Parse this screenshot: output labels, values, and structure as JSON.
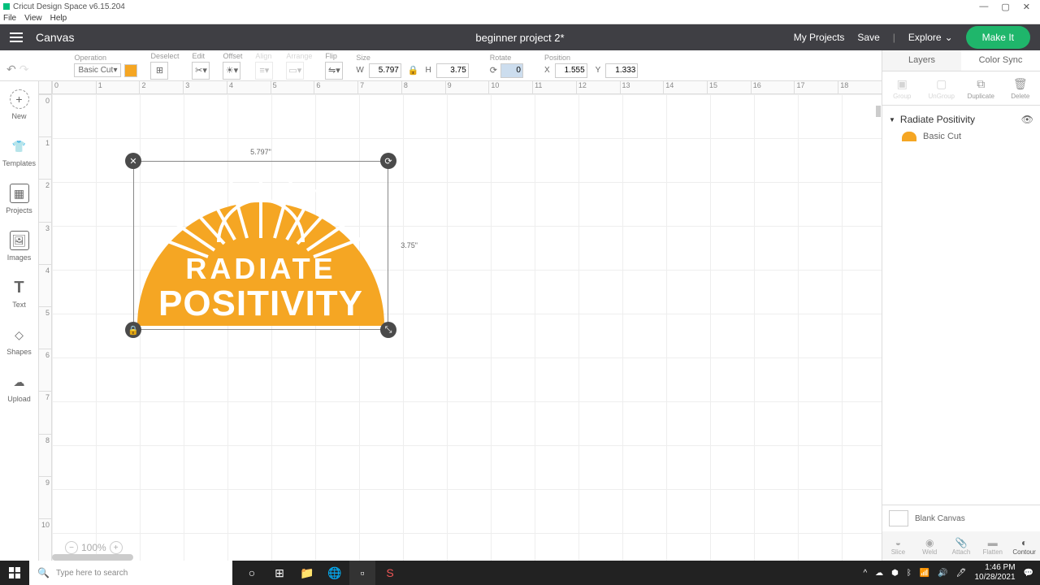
{
  "titlebar": {
    "title": "Cricut Design Space v6.15.204"
  },
  "menubar": {
    "file": "File",
    "view": "View",
    "help": "Help"
  },
  "header": {
    "canvas": "Canvas",
    "project_title": "beginner project 2*",
    "my_projects": "My Projects",
    "save": "Save",
    "explore": "Explore",
    "make_it": "Make It"
  },
  "toolbar": {
    "operation_label": "Operation",
    "operation_value": "Basic Cut",
    "deselect": "Deselect",
    "edit": "Edit",
    "offset": "Offset",
    "align": "Align",
    "arrange": "Arrange",
    "flip": "Flip",
    "size_label": "Size",
    "w": "W",
    "w_val": "5.797",
    "h": "H",
    "h_val": "3.75",
    "rotate_label": "Rotate",
    "rotate_val": "0",
    "position_label": "Position",
    "x": "X",
    "x_val": "1.555",
    "y": "Y",
    "y_val": "1.333"
  },
  "sidebar": {
    "new": "New",
    "templates": "Templates",
    "projects": "Projects",
    "images": "Images",
    "text": "Text",
    "shapes": "Shapes",
    "upload": "Upload"
  },
  "canvas": {
    "sel_width": "5.797\"",
    "sel_height": "3.75\"",
    "art_line1": "RADIATE",
    "art_line2": "POSITIVITY",
    "zoom": "100%"
  },
  "right_panel": {
    "layers_tab": "Layers",
    "colorsync_tab": "Color Sync",
    "group": "Group",
    "ungroup": "UnGroup",
    "duplicate": "Duplicate",
    "delete": "Delete",
    "layer_name": "Radiate Positivity",
    "layer_cut": "Basic Cut",
    "blank_canvas": "Blank Canvas",
    "slice": "Slice",
    "weld": "Weld",
    "attach": "Attach",
    "flatten": "Flatten",
    "contour": "Contour"
  },
  "taskbar": {
    "search_placeholder": "Type here to search",
    "time": "1:46 PM",
    "date": "10/28/2021"
  },
  "ruler_h": [
    "0",
    "1",
    "2",
    "3",
    "4",
    "5",
    "6",
    "7",
    "8",
    "9",
    "10",
    "11",
    "12",
    "13",
    "14",
    "15",
    "16",
    "17",
    "18"
  ],
  "ruler_v": [
    "0",
    "1",
    "2",
    "3",
    "4",
    "5",
    "6",
    "7",
    "8",
    "9",
    "10"
  ]
}
